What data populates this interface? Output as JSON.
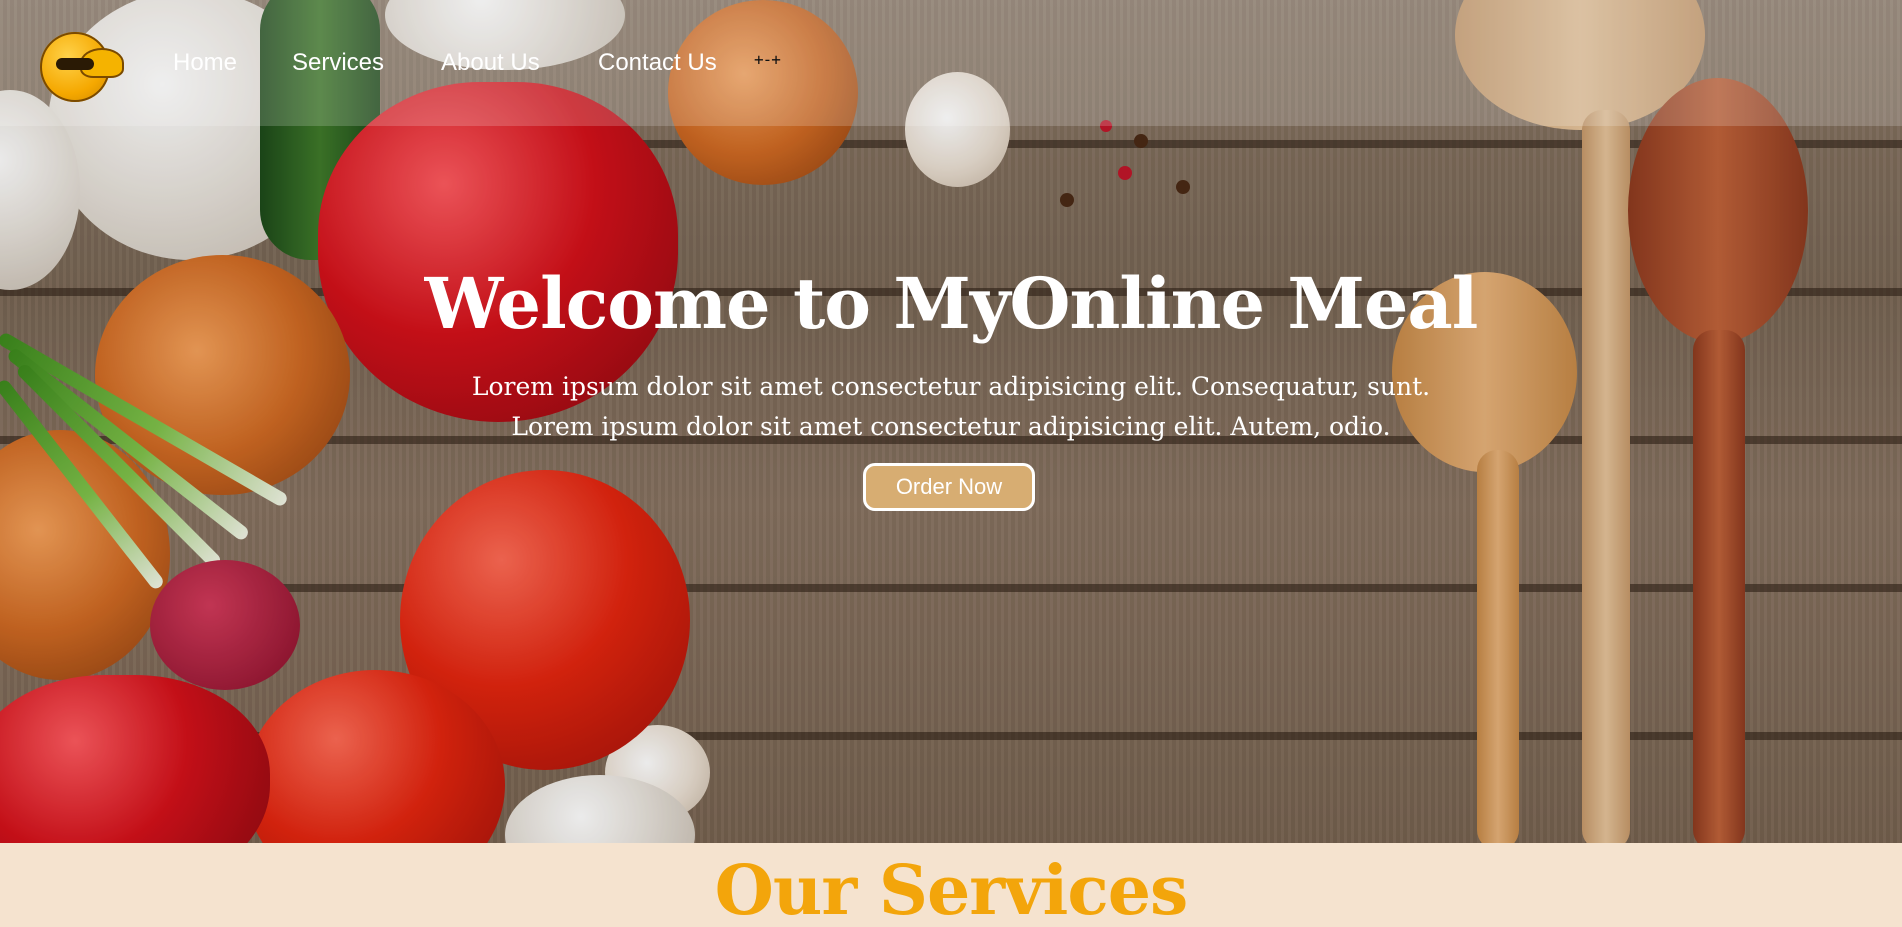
{
  "nav": {
    "items": [
      {
        "label": "Home"
      },
      {
        "label": "Services"
      },
      {
        "label": "About Us"
      },
      {
        "label": "Contact Us"
      }
    ],
    "extra": "+-+",
    "logo": "chef-logo-icon"
  },
  "hero": {
    "title": "Welcome to MyOnline Meal",
    "subtitle_line1": "Lorem ipsum dolor sit amet consectetur adipisicing elit. Consequatur, sunt.",
    "subtitle_line2": "Lorem ipsum dolor sit amet consectetur adipisicing elit. Autem, odio.",
    "cta_label": "Order Now"
  },
  "services": {
    "title": "Our Services"
  },
  "colors": {
    "accent": "#f3a50b",
    "button": "#d7ad72",
    "section_bg": "#f5e3cf"
  }
}
